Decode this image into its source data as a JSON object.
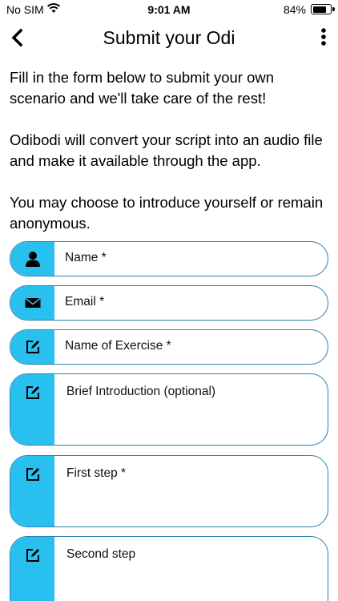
{
  "status_bar": {
    "carrier": "No SIM",
    "time": "9:01 AM",
    "battery_percent": "84%",
    "battery_level": 0.84
  },
  "nav": {
    "title": "Submit your Odi",
    "back_icon": "chevron-left-icon",
    "menu_icon": "more-vertical-icon"
  },
  "intro": {
    "paragraph_1": "Fill in the form below to submit your own scenario and we'll take care of the rest!",
    "paragraph_2": "Odibodi will convert your script into an audio file and make it available through the app.",
    "paragraph_3": "You may choose to introduce yourself or remain anonymous."
  },
  "colors": {
    "icon_background": "#29c0f0",
    "field_border": "#2b7fb0"
  },
  "form": {
    "name": {
      "placeholder": "Name *",
      "icon": "user-icon"
    },
    "email": {
      "placeholder": "Email *",
      "icon": "envelope-icon"
    },
    "exercise_name": {
      "placeholder": "Name of Exercise *",
      "icon": "edit-icon"
    },
    "brief_intro": {
      "placeholder": "Brief Introduction (optional)",
      "icon": "edit-icon"
    },
    "first_step": {
      "placeholder": "First step *",
      "icon": "edit-icon"
    },
    "second_step": {
      "placeholder": "Second step",
      "icon": "edit-icon"
    }
  }
}
